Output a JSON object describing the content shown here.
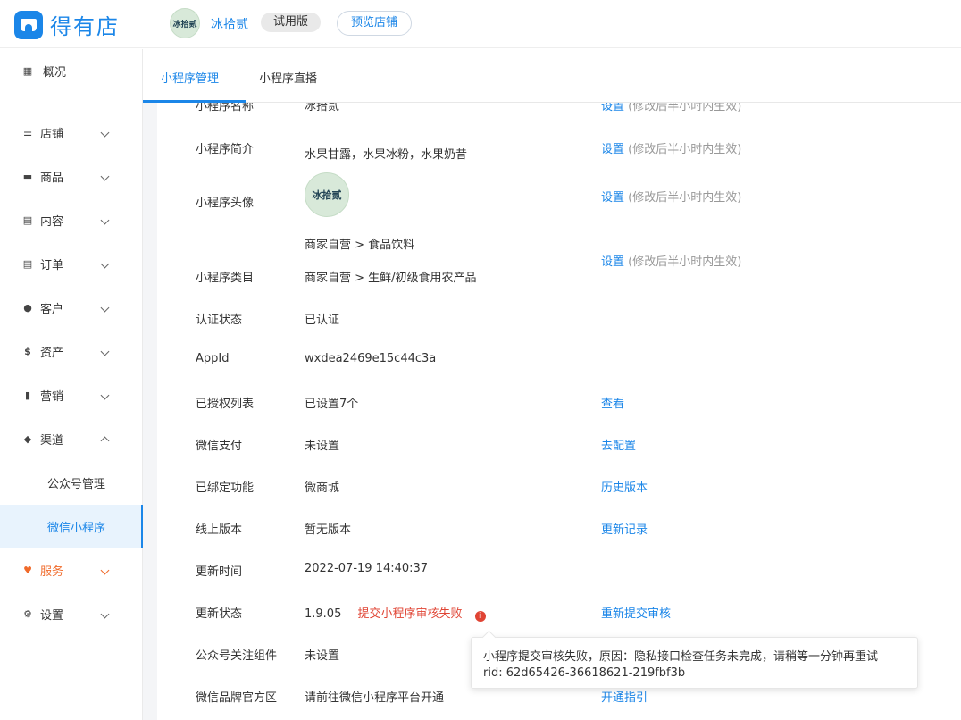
{
  "header": {
    "logo_text": "得有店",
    "avatar_text": "冰拾贰",
    "store_name": "冰拾贰",
    "trial_badge": "试用版",
    "preview_button": "预览店铺"
  },
  "sidebar": {
    "items": [
      {
        "label": "概况",
        "icon": "grid-icon"
      },
      {
        "label": "店铺",
        "icon": "sliders-icon"
      },
      {
        "label": "商品",
        "icon": "box-icon"
      },
      {
        "label": "内容",
        "icon": "document-icon"
      },
      {
        "label": "订单",
        "icon": "list-icon"
      },
      {
        "label": "客户",
        "icon": "users-icon"
      },
      {
        "label": "资产",
        "icon": "dollar-icon"
      },
      {
        "label": "营销",
        "icon": "bar-chart-icon"
      },
      {
        "label": "渠道",
        "icon": "layers-icon"
      },
      {
        "label": "服务",
        "icon": "heart-icon"
      },
      {
        "label": "设置",
        "icon": "gear-icon"
      }
    ],
    "sub_items": [
      {
        "label": "公众号管理"
      },
      {
        "label": "微信小程序"
      }
    ],
    "accent_color": "#1b86e8",
    "service_color": "#f06a2a"
  },
  "tabs": [
    {
      "label": "小程序管理"
    },
    {
      "label": "小程序直播"
    }
  ],
  "rows": {
    "name": {
      "label": "小程序名称",
      "value": "冰拾贰",
      "action": "设置",
      "hint": "(修改后半小时内生效)"
    },
    "intro": {
      "label": "小程序简介",
      "value": "水果甘露，水果冰粉，水果奶昔",
      "action": "设置",
      "hint": "(修改后半小时内生效)"
    },
    "avatar": {
      "label": "小程序头像",
      "avatar_text": "冰拾贰",
      "action": "设置",
      "hint": "(修改后半小时内生效)"
    },
    "category": {
      "label": "小程序类目",
      "value1": "商家自营 > 食品饮料",
      "value2": "商家自营 > 生鲜/初级食用农产品",
      "action": "设置",
      "hint": "(修改后半小时内生效)"
    },
    "auth": {
      "label": "认证状态",
      "value": "已认证"
    },
    "appid": {
      "label": "AppId",
      "value": "wxdea2469e15c44c3a"
    },
    "authorized": {
      "label": "已授权列表",
      "value": "已设置7个",
      "action": "查看"
    },
    "pay": {
      "label": "微信支付",
      "value": "未设置",
      "action": "去配置"
    },
    "bound": {
      "label": "已绑定功能",
      "value": "微商城",
      "action": "历史版本"
    },
    "online": {
      "label": "线上版本",
      "value": "暂无版本",
      "action": "更新记录"
    },
    "update_time": {
      "label": "更新时间",
      "value": "2022-07-19 14:40:37"
    },
    "update_status": {
      "label": "更新状态",
      "version": "1.9.05",
      "error": "提交小程序审核失败",
      "action": "重新提交审核"
    },
    "follow": {
      "label": "公众号关注组件",
      "value": "未设置"
    },
    "brand": {
      "label": "微信品牌官方区",
      "value": "请前往微信小程序平台开通",
      "action": "开通指引"
    }
  },
  "tooltip": {
    "line1": "小程序提交审核失败，原因：隐私接口检查任务未完成，请稍等一分钟再重试",
    "line2": "rid: 62d65426-36618621-219fbf3b"
  }
}
